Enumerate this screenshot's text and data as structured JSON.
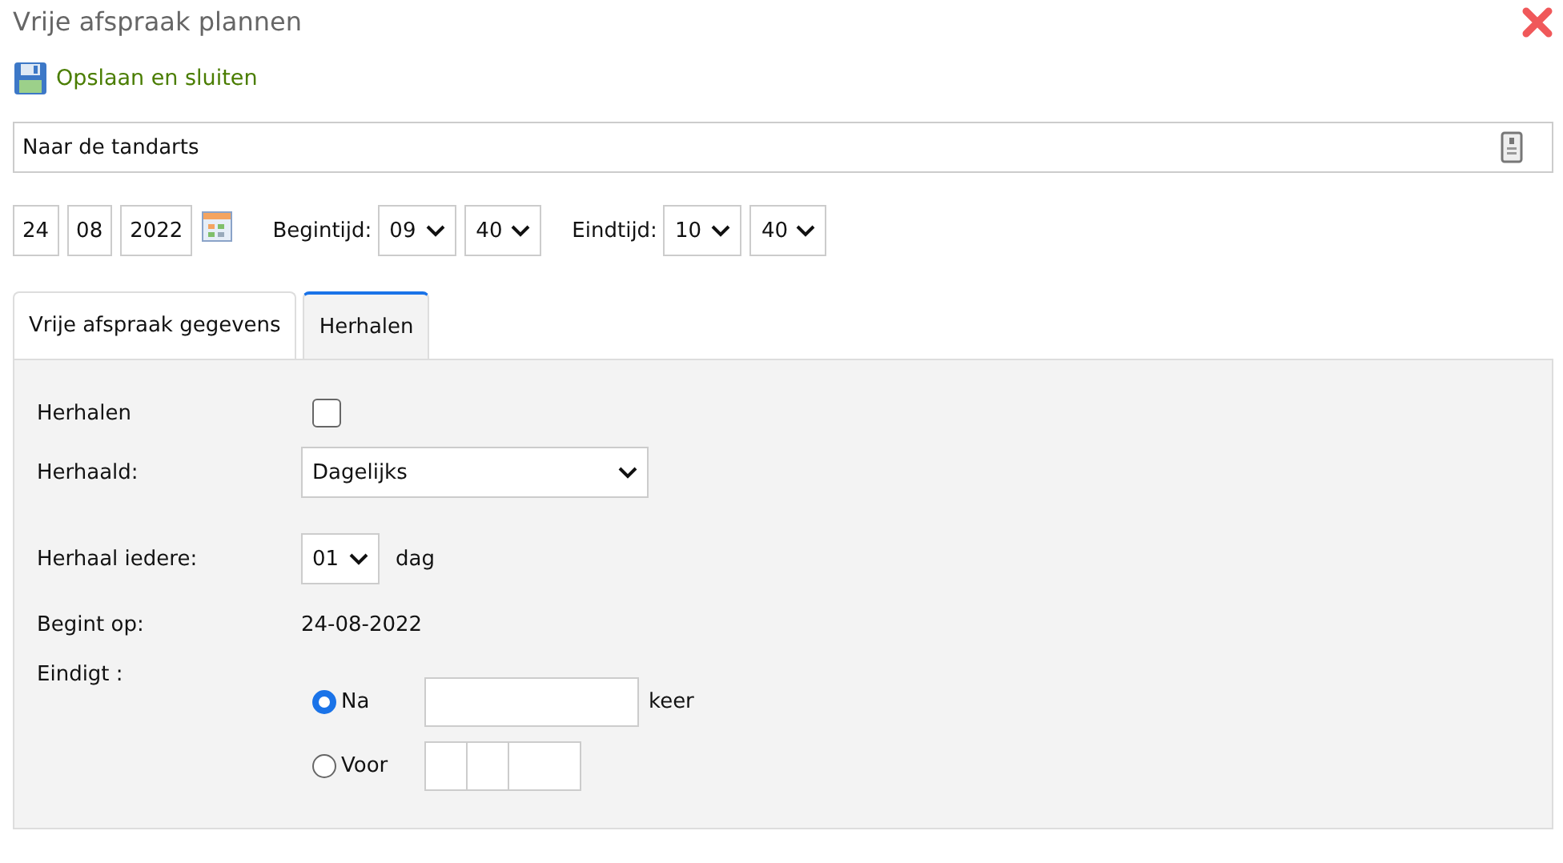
{
  "window": {
    "title": "Vrije afspraak plannen"
  },
  "toolbar": {
    "save_label": "Opslaan en sluiten"
  },
  "subject": {
    "value": "Naar de tandarts"
  },
  "date": {
    "day": "24",
    "month": "08",
    "year": "2022"
  },
  "start": {
    "label": "Begintijd:",
    "hour": "09",
    "minute": "40"
  },
  "end": {
    "label": "Eindtijd:",
    "hour": "10",
    "minute": "40"
  },
  "tabs": [
    {
      "label": "Vrije afspraak gegevens",
      "selected": false
    },
    {
      "label": "Herhalen",
      "selected": true
    }
  ],
  "repeat": {
    "enable": {
      "label": "Herhalen",
      "checked": false
    },
    "frequency": {
      "label": "Herhaald:",
      "value": "Dagelijks"
    },
    "interval": {
      "label": "Herhaal iedere:",
      "value": "01",
      "unit": "dag"
    },
    "starts": {
      "label": "Begint op:",
      "value": "24-08-2022"
    },
    "ends": {
      "label": "Eindigt :",
      "options": [
        {
          "kind": "count",
          "label": "Na",
          "selected": true,
          "unit": "keer"
        },
        {
          "kind": "date",
          "label": "Voor",
          "selected": false
        }
      ]
    }
  }
}
